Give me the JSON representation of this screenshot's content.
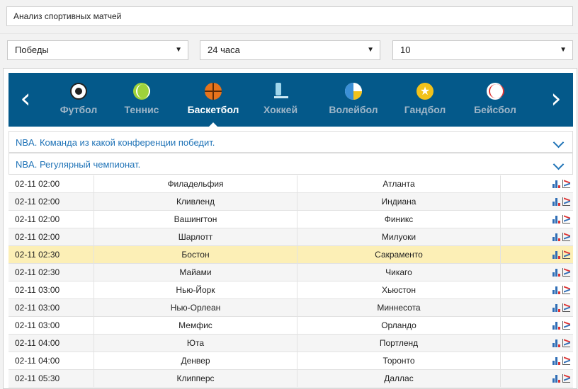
{
  "header": {
    "title_value": "Анализ спортивных матчей"
  },
  "filters": {
    "result": "Победы",
    "period": "24 часа",
    "count": "10",
    "arrow": "▼"
  },
  "sport_nav": {
    "prev": "‹",
    "next": "›",
    "sports": [
      {
        "label": "Футбол",
        "icon": "football-icon"
      },
      {
        "label": "Теннис",
        "icon": "tennis-ball-icon"
      },
      {
        "label": "Баскетбол",
        "icon": "basketball-icon",
        "active": true
      },
      {
        "label": "Хоккей",
        "icon": "ice-skate-icon"
      },
      {
        "label": "Волейбол",
        "icon": "volleyball-icon"
      },
      {
        "label": "Гандбол",
        "icon": "handball-icon"
      },
      {
        "label": "Бейсбол",
        "icon": "baseball-icon"
      }
    ]
  },
  "leagues": [
    "NBA. Команда из какой конференции победит.",
    "NBA. Регулярный чемпионат."
  ],
  "matches": [
    {
      "time": "02-11 02:00",
      "home": "Филадельфия",
      "away": "Атланта"
    },
    {
      "time": "02-11 02:00",
      "home": "Кливленд",
      "away": "Индиана"
    },
    {
      "time": "02-11 02:00",
      "home": "Вашингтон",
      "away": "Финикс"
    },
    {
      "time": "02-11 02:00",
      "home": "Шарлотт",
      "away": "Милуоки"
    },
    {
      "time": "02-11 02:30",
      "home": "Бостон",
      "away": "Сакраменто",
      "highlighted": true
    },
    {
      "time": "02-11 02:30",
      "home": "Майами",
      "away": "Чикаго"
    },
    {
      "time": "02-11 03:00",
      "home": "Нью-Йорк",
      "away": "Хьюстон"
    },
    {
      "time": "02-11 03:00",
      "home": "Нью-Орлеан",
      "away": "Миннесота"
    },
    {
      "time": "02-11 03:00",
      "home": "Мемфис",
      "away": "Орландо"
    },
    {
      "time": "02-11 04:00",
      "home": "Юта",
      "away": "Портленд"
    },
    {
      "time": "02-11 04:00",
      "home": "Денвер",
      "away": "Торонто"
    },
    {
      "time": "02-11 05:30",
      "home": "Клипперс",
      "away": "Даллас"
    }
  ],
  "colors": {
    "nav_bg": "#04598a",
    "league_text": "#1f73b7",
    "highlight_row": "#fcefb6"
  }
}
